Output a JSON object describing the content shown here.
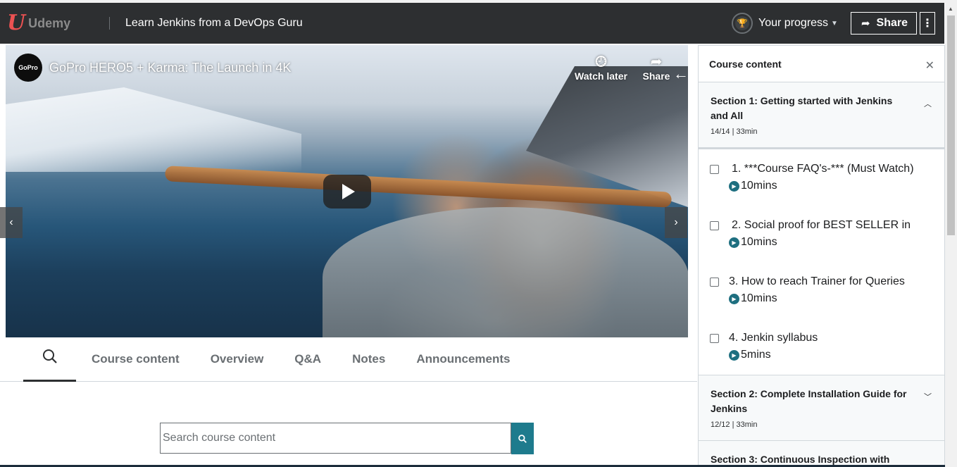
{
  "app": {
    "brand": "Udemy",
    "course_title": "Learn Jenkins from a DevOps Guru",
    "progress_label": "Your progress",
    "share_label": "Share",
    "more_label": "⋮",
    "colors": {
      "topbar": "#2d2f31",
      "brand": "#ec5252",
      "accent": "#1e7b8d"
    }
  },
  "video": {
    "channel_badge": "GoPro",
    "title": "GoPro HERO5 + Karma: The Launch in 4K",
    "watch_later_label": "Watch later",
    "share_label": "Share"
  },
  "tabs": {
    "search_icon": "search-icon",
    "items": [
      {
        "label": "Course content"
      },
      {
        "label": "Overview"
      },
      {
        "label": "Q&A"
      },
      {
        "label": "Notes"
      },
      {
        "label": "Announcements"
      }
    ]
  },
  "search": {
    "placeholder": "Search course content",
    "value": ""
  },
  "sidebar": {
    "title": "Course content",
    "sections": [
      {
        "title": "Section 1: Getting started with Jenkins and All",
        "meta": "14/14 | 33min",
        "expanded": true,
        "items": [
          {
            "title": "1. ***Course FAQ's-*** (Must Watch)",
            "duration": "10mins"
          },
          {
            "title": "2. Social proof for BEST SELLER in",
            "duration": "10mins"
          },
          {
            "title": "3. How to reach Trainer for Queries",
            "duration": "10mins"
          },
          {
            "title": "4. Jenkin syllabus",
            "duration": "5mins"
          }
        ]
      },
      {
        "title": "Section 2: Complete Installation Guide for Jenkins",
        "meta": "12/12 | 33min",
        "expanded": false
      },
      {
        "title": "Section 3: Continuous Inspection with",
        "meta": "",
        "expanded": false
      }
    ]
  }
}
